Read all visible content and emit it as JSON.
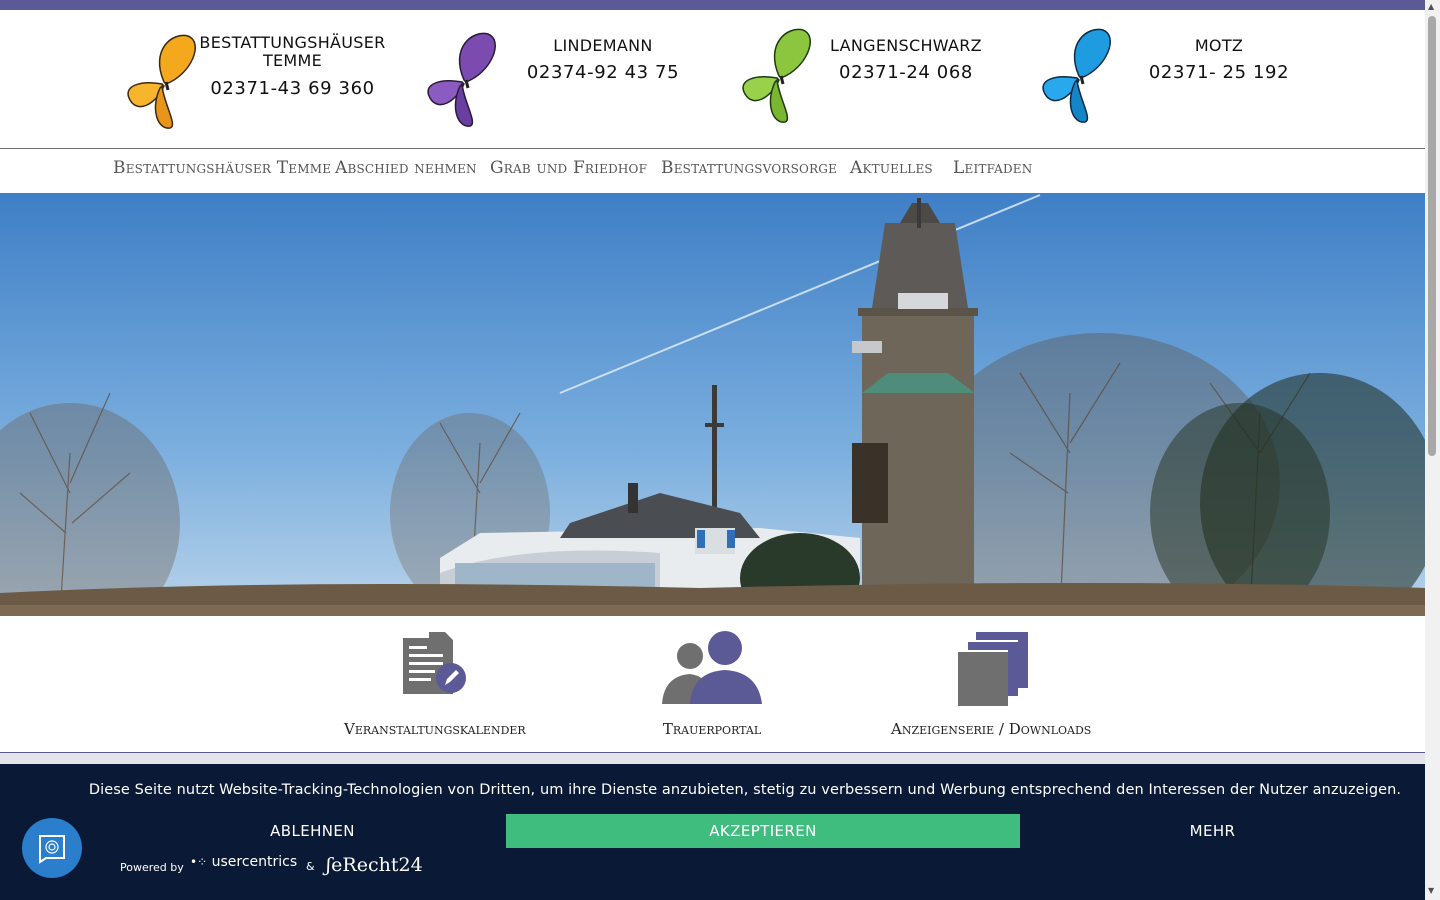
{
  "header": {
    "brands": [
      {
        "name": "BESTATTUNGSHÄUSER TEMME",
        "name_line1": "BESTATTUNGSHÄUSER",
        "name_line2": "TEMME",
        "phone": "02371-43 69 360",
        "butterfly_icon": "orange-butterfly-icon",
        "color": "#f3a81d"
      },
      {
        "name": "LINDEMANN",
        "phone": "02374-92 43 75",
        "butterfly_icon": "purple-butterfly-icon",
        "color": "#7b4bb0"
      },
      {
        "name": "LANGENSCHWARZ",
        "phone": "02371-24 068",
        "butterfly_icon": "green-butterfly-icon",
        "color": "#8cc63f"
      },
      {
        "name": "MOTZ",
        "phone": "02371- 25 192",
        "butterfly_icon": "blue-butterfly-icon",
        "color": "#1f9be0"
      }
    ]
  },
  "nav": {
    "items": [
      "Bestattungshäuser Temme",
      "Abschied nehmen",
      "Grab und Friedhof",
      "Bestattungsvorsorge",
      "Aktuelles",
      "Leitfaden"
    ]
  },
  "features": [
    {
      "label": "Veranstaltungskalender",
      "icon": "document-edit-icon"
    },
    {
      "label": "Trauerportal",
      "icon": "people-icon"
    },
    {
      "label": "Anzeigenserie / Downloads",
      "icon": "stacked-pages-icon"
    }
  ],
  "cookie": {
    "text": "Diese Seite nutzt Website-Tracking-Technologien von Dritten, um ihre Dienste anzubieten, stetig zu verbessern und Werbung entsprechend den Interessen der Nutzer anzuzeigen.",
    "decline": "ABLEHNEN",
    "accept": "AKZEPTIEREN",
    "more": "MEHR",
    "powered_by": "Powered by",
    "usercentrics": "usercentrics",
    "ampersand": "&",
    "erecht": "eRecht24"
  },
  "colors": {
    "accent": "#5b5a96",
    "accept": "#3ebd7f",
    "cookie_bg": "#0a1a36",
    "fab": "#2b7ecb"
  }
}
